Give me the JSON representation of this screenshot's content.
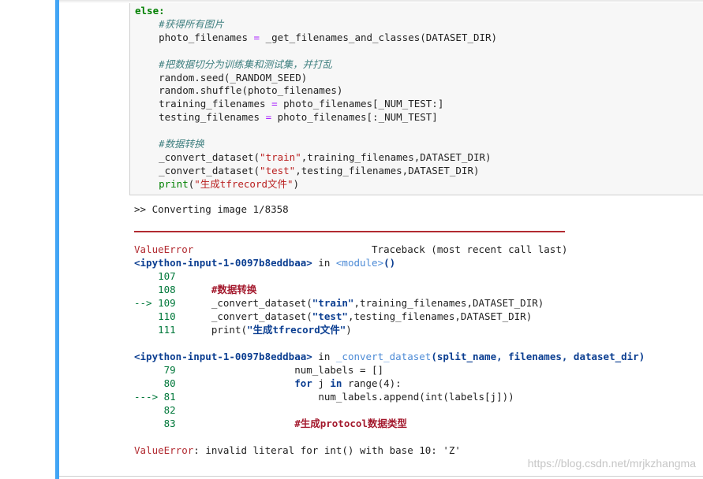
{
  "input_code": {
    "l1": "else:",
    "l2": "    #获得所有图片",
    "l3_a": "    photo_filenames ",
    "l3_b": "=",
    "l3_c": " _get_filenames_and_classes(DATASET_DIR)",
    "l5": "    #把数据切分为训练集和测试集，并打乱",
    "l6": "    random.seed(_RANDOM_SEED)",
    "l7": "    random.shuffle(photo_filenames)",
    "l8_a": "    training_filenames ",
    "l8_b": "=",
    "l8_c": " photo_filenames[_NUM_TEST:]",
    "l9_a": "    testing_filenames ",
    "l9_b": "=",
    "l9_c": " photo_filenames[:_NUM_TEST]",
    "l11": "    #数据转换",
    "l12_a": "    _convert_dataset(",
    "l12_b": "\"train\"",
    "l12_c": ",training_filenames,DATASET_DIR)",
    "l13_a": "    _convert_dataset(",
    "l13_b": "\"test\"",
    "l13_c": ",testing_filenames,DATASET_DIR)",
    "l14_a": "    ",
    "l14_b": "print",
    "l14_c": "(",
    "l14_d": "\"生成tfrecord文件\"",
    "l14_e": ")"
  },
  "output": {
    "stream": ">> Converting image 1/8358",
    "error_name": "ValueError",
    "traceback_label": "                              Traceback (most recent call last)",
    "frame1": {
      "file": "<ipython-input-1-0097b8eddbaa>",
      "in": " in ",
      "module": "<module>",
      "paren": "()",
      "lines": [
        {
          "no": "    107",
          "pad": "",
          "code": ""
        },
        {
          "no": "    108",
          "pad": "      ",
          "code": "#数据转换"
        },
        {
          "no": "--> 109",
          "pad": "      ",
          "code_a": "_convert_dataset(",
          "code_b": "\"train\"",
          "code_c": ",training_filenames,DATASET_DIR)"
        },
        {
          "no": "    110",
          "pad": "      ",
          "code_a": "_convert_dataset(",
          "code_b": "\"test\"",
          "code_c": ",testing_filenames,DATASET_DIR)"
        },
        {
          "no": "    111",
          "pad": "      ",
          "code_a": "print(",
          "code_b": "\"生成tfrecord文件\"",
          "code_c": ")"
        }
      ]
    },
    "frame2": {
      "file": "<ipython-input-1-0097b8eddbaa>",
      "in": " in ",
      "func": "_convert_dataset",
      "args": "(split_name, filenames, dataset_dir)",
      "lines": [
        {
          "no": "     79",
          "pad": "                    ",
          "code": "num_labels = []"
        },
        {
          "no": "     80",
          "pad": "                    ",
          "code_a": "for",
          "code_b": " j ",
          "code_c": "in",
          "code_d": " range(4):"
        },
        {
          "no": "---> 81",
          "pad": "                        ",
          "code": "num_labels.append(int(labels[j]))"
        },
        {
          "no": "     82",
          "pad": "",
          "code": ""
        },
        {
          "no": "     83",
          "pad": "                    ",
          "code": "#生成protocol数据类型"
        }
      ]
    },
    "final_error_name": "ValueError",
    "final_error_msg": ": invalid literal for int() with base 10: 'Z'"
  },
  "watermark": "https://blog.csdn.net/mrjkzhangma"
}
